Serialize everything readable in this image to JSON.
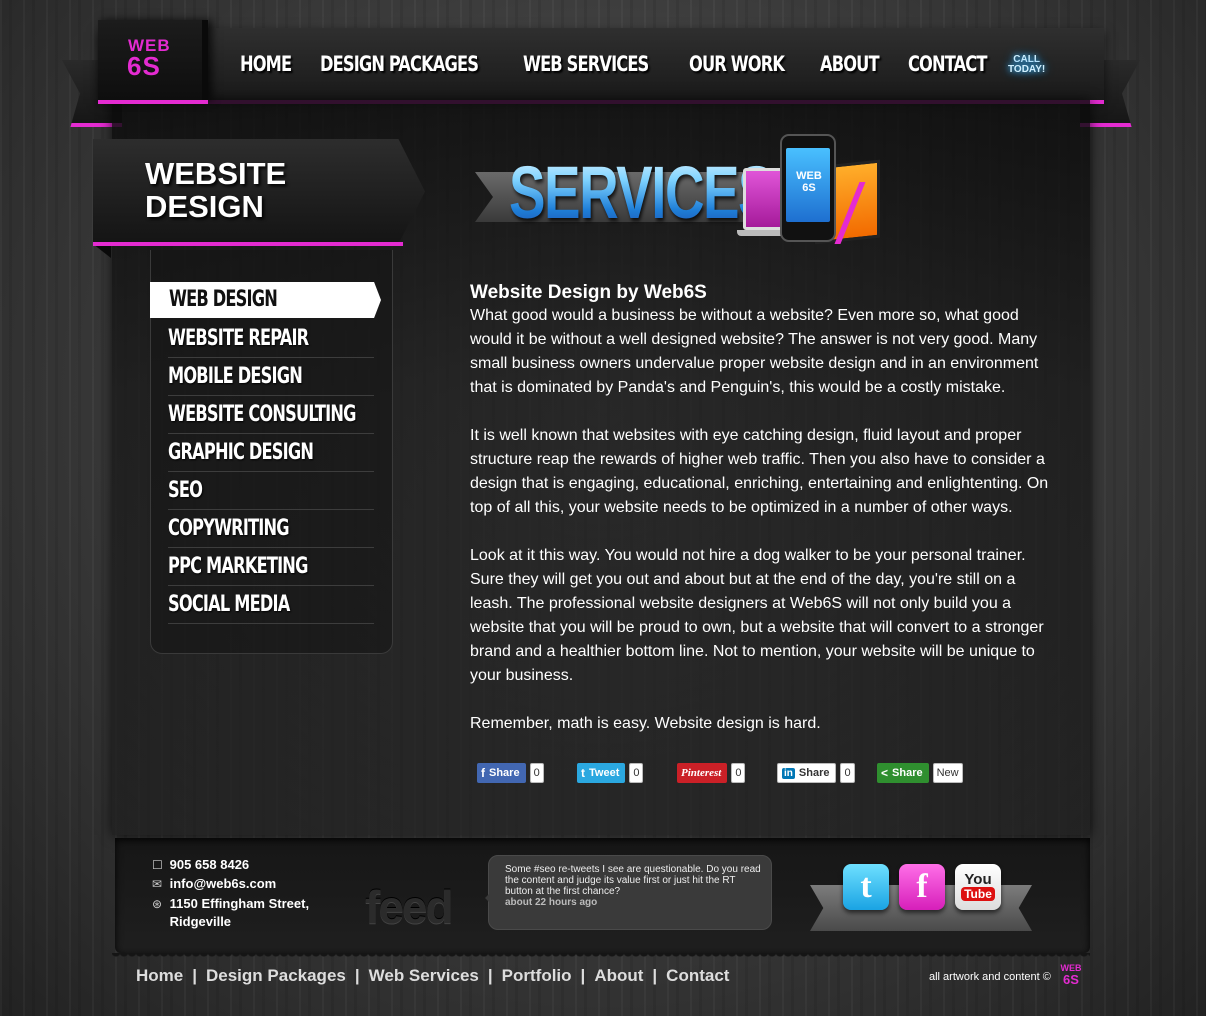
{
  "header": {
    "logo_line1": "WEB",
    "logo_line2": "6S",
    "nav": [
      "HOME",
      "DESIGN PACKAGES",
      "WEB SERVICES",
      "OUR WORK",
      "ABOUT",
      "CONTACT"
    ],
    "call_line1": "CALL",
    "call_line2": "TODAY!"
  },
  "page_title_line1": "WEBSITE",
  "page_title_line2": "DESIGN",
  "banner": {
    "title": "SERVICES",
    "screen_line1": "WEB",
    "screen_line2": "6S"
  },
  "sidebar": {
    "items": [
      "WEB DESIGN",
      "WEBSITE REPAIR",
      "MOBILE DESIGN",
      "WEBSITE CONSULTING",
      "GRAPHIC DESIGN",
      "SEO",
      "COPYWRITING",
      "PPC MARKETING",
      "SOCIAL MEDIA"
    ],
    "active_index": 0
  },
  "article": {
    "title": "Website Design by Web6S",
    "paragraphs": [
      "What good would a business be without a website? Even more so, what good would it be without a well designed website? The answer is not very good. Many small business owners undervalue proper website design and in an environment that is dominated by Panda's and Penguin's, this would be a costly mistake.",
      "It is well known that websites with eye catching design, fluid layout and proper structure reap the rewards of higher web traffic. Then you also have to consider a design that is engaging, educational, enriching, entertaining and enlightenting. On top of all this, your website needs to be optimized in a number of other ways.",
      "Look at it this way. You would not hire a dog walker to be your personal trainer. Sure they will get you out and about but at the end of the day, you're still on a leash. The professional website designers at Web6S will not only build you a website that you will be proud to own, but a website that will convert to a stronger brand and a healthier bottom line. Not to mention, your website will be unique to your business.",
      "Remember, math is easy. Website design is hard."
    ]
  },
  "share": [
    {
      "icon": "f",
      "label": "Share",
      "count": "0",
      "color": "#3b5998"
    },
    {
      "icon": "t",
      "label": "Tweet",
      "count": "0",
      "color": "#2ba8e0"
    },
    {
      "icon": "",
      "label": "Pinterest",
      "count": "0",
      "color": "#cb2027"
    },
    {
      "icon": "in",
      "label": "Share",
      "count": "0",
      "color": "#ffffff"
    },
    {
      "icon": "<",
      "label": "Share",
      "count": "New",
      "color": "#2f8f2f"
    }
  ],
  "footer": {
    "phone": "905 658 8426",
    "email": "info@web6s.com",
    "address_line1": "1150 Effingham Street,",
    "address_line2": "Ridgeville",
    "feed_label": "feed",
    "feed_text": "Some #seo re-tweets I see are questionable. Do you read the content and judge its value first or just hit the RT button at the first chance?",
    "feed_time": "about 22 hours ago",
    "social": {
      "twitter": "t",
      "facebook": "f",
      "youtube_you": "You",
      "youtube_tube": "Tube"
    },
    "nav": [
      "Home",
      "Design Packages",
      "Web Services",
      "Portfolio",
      "About",
      "Contact"
    ],
    "separator": "|",
    "copyright": "all artwork and content ©",
    "mini_logo_line1": "WEB",
    "mini_logo_line2": "6S"
  },
  "colors": {
    "accent": "#e42bd1",
    "banner_blue": "#1f7fd8"
  }
}
